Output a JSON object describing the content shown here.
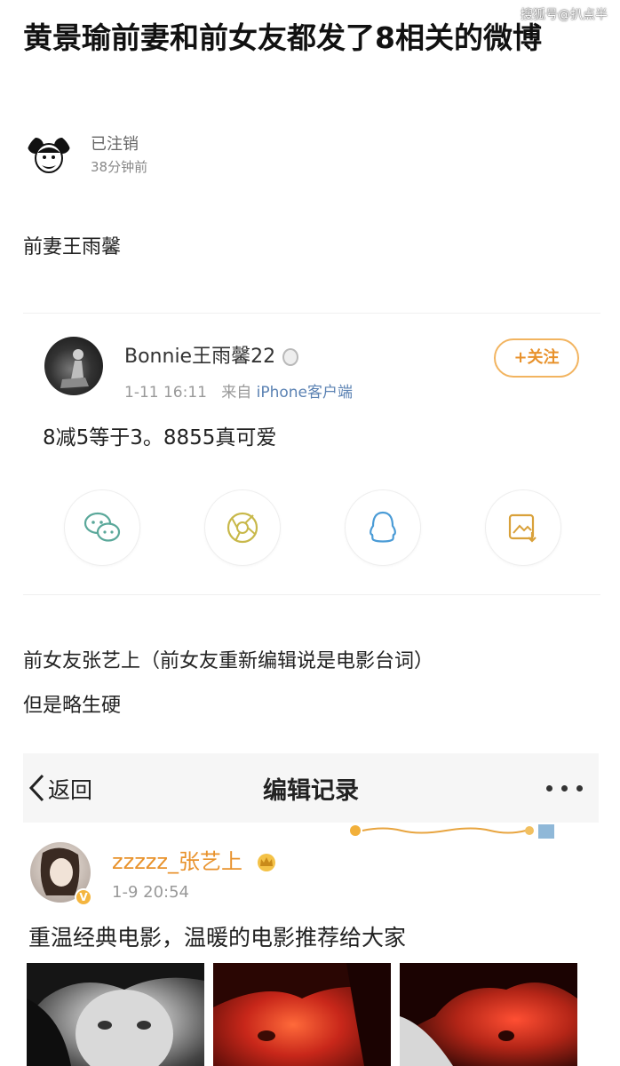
{
  "watermark": "搜狐号@扒点半",
  "article": {
    "title": "黄景瑜前妻和前女友都发了8相关的微博",
    "author_name": "已注销",
    "author_time": "38分钟前"
  },
  "section1_label": "前妻王雨馨",
  "weibo1": {
    "username": "Bonnie王雨馨22",
    "date": "1-11 16:11",
    "source_prefix": "来自",
    "source_device": "iPhone客户端",
    "follow_label": "+关注",
    "content": "8减5等于3。8855真可爱",
    "share_icons": [
      "wechat-icon",
      "moments-icon",
      "qq-icon",
      "save-image-icon"
    ]
  },
  "section2_label_line1": "前女友张艺上（前女友重新编辑说是电影台词）",
  "section2_label_line2": "但是略生硬",
  "weibo2": {
    "back_label": "返回",
    "nav_title": "编辑记录",
    "username": "zzzzz_张艺上",
    "verified_badge": "V",
    "time": "1-9 20:54",
    "content": "重温经典电影，温暖的电影推荐给大家"
  },
  "colors": {
    "accent_orange": "#e8922c",
    "follow_border": "#f2b460",
    "link_blue": "#5b82b3"
  }
}
